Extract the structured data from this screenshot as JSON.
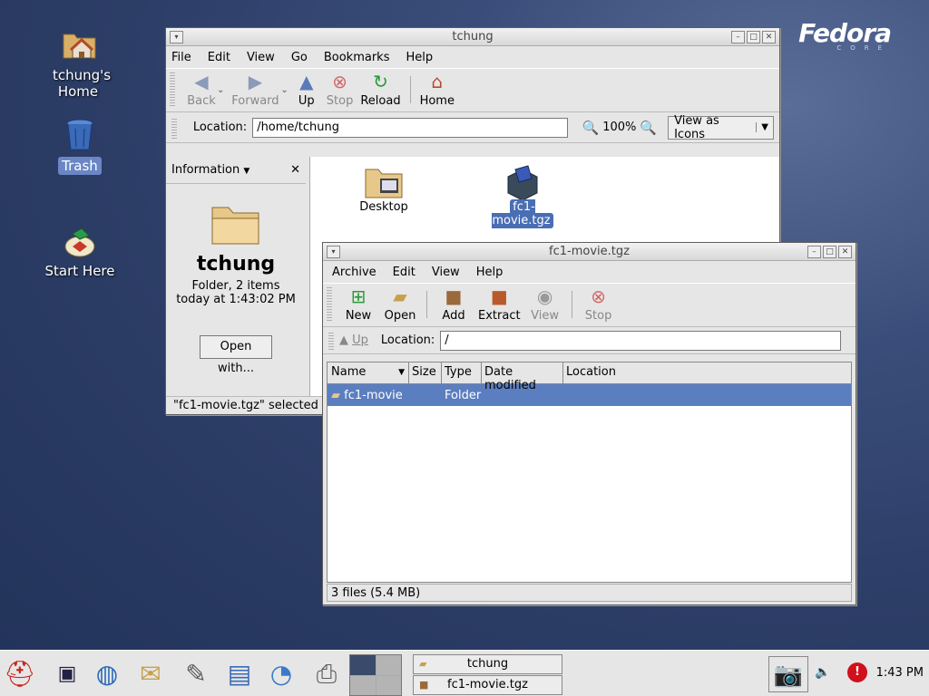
{
  "desktop": {
    "icons": [
      {
        "label": "tchung's Home",
        "icon": "home-folder-icon"
      },
      {
        "label": "Trash",
        "icon": "trash-icon"
      },
      {
        "label": "Start Here",
        "icon": "start-here-icon"
      }
    ],
    "logo": {
      "text": "Fedora",
      "subtext": "CORE"
    }
  },
  "nautilus": {
    "title": "tchung",
    "menu": [
      "File",
      "Edit",
      "View",
      "Go",
      "Bookmarks",
      "Help"
    ],
    "toolbar": {
      "back": "Back",
      "forward": "Forward",
      "up": "Up",
      "stop": "Stop",
      "reload": "Reload",
      "home": "Home"
    },
    "location_label": "Location:",
    "location_value": "/home/tchung",
    "zoom": "100%",
    "view_mode": "View as Icons",
    "sidebar": {
      "header": "Information",
      "name": "tchung",
      "desc1": "Folder, 2 items",
      "desc2": "today at 1:43:02 PM",
      "open_with": "Open with..."
    },
    "files": [
      {
        "name": "Desktop",
        "icon": "desktop-folder-icon"
      },
      {
        "name": "fc1-movie.tgz",
        "icon": "archive-package-icon"
      }
    ],
    "status": "\"fc1-movie.tgz\" selected (4"
  },
  "roller": {
    "title": "fc1-movie.tgz",
    "menu": [
      "Archive",
      "Edit",
      "View",
      "Help"
    ],
    "toolbar": {
      "new": "New",
      "open": "Open",
      "add": "Add",
      "extract": "Extract",
      "view": "View",
      "stop": "Stop"
    },
    "up": "Up",
    "location_label": "Location:",
    "location_value": "/",
    "columns": [
      "Name",
      "Size",
      "Type",
      "Date modified",
      "Location"
    ],
    "rows": [
      {
        "name": "fc1-movie",
        "size": "",
        "type": "Folder",
        "date": "",
        "location": ""
      }
    ],
    "status": "3 files (5.4 MB)"
  },
  "taskbar": {
    "tasks": [
      "tchung",
      "fc1-movie.tgz"
    ],
    "clock": "1:43 PM"
  }
}
